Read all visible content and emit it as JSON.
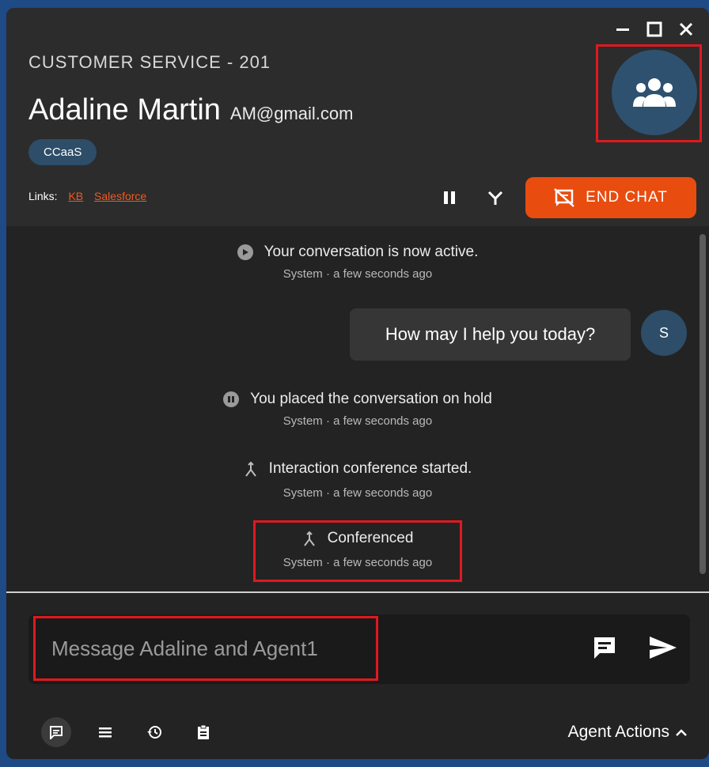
{
  "header": {
    "queue_label": "CUSTOMER SERVICE - 201",
    "customer_name": "Adaline Martin",
    "customer_email": "AM@gmail.com",
    "tag": "CCaaS",
    "links_label": "Links:",
    "links": [
      "KB",
      "Salesforce"
    ],
    "end_chat_label": "END CHAT",
    "accent_color": "#e84c0f"
  },
  "window_controls": [
    "minimize-icon",
    "maximize-icon",
    "close-icon"
  ],
  "messages": [
    {
      "type": "system",
      "icon": "play-icon",
      "text": "Your conversation is now active.",
      "meta": "System · a few seconds ago"
    },
    {
      "type": "agent",
      "text": "How may I help you today?",
      "avatar": "S"
    },
    {
      "type": "system",
      "icon": "pause-icon",
      "text": "You placed the conversation on hold",
      "meta": "System · a few seconds ago"
    },
    {
      "type": "system",
      "icon": "merge-icon",
      "text": "Interaction conference started.",
      "meta": "System · a few seconds ago"
    },
    {
      "type": "system",
      "icon": "merge-icon",
      "text": "Conferenced",
      "meta": "System · a few seconds ago"
    }
  ],
  "composer": {
    "placeholder": "Message Adaline and Agent1"
  },
  "footer": {
    "tabs": [
      "chat-icon",
      "list-icon",
      "history-icon",
      "clipboard-icon"
    ],
    "agent_actions_label": "Agent Actions"
  }
}
